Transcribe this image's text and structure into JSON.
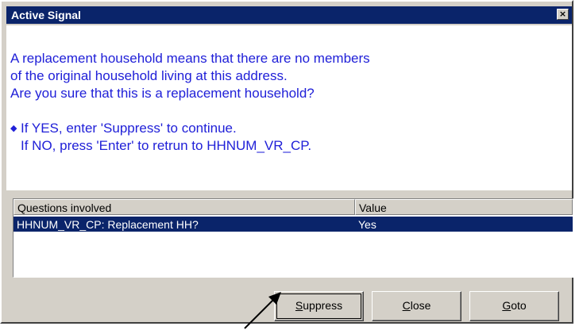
{
  "window": {
    "title": "Active Signal",
    "close_glyph": "×"
  },
  "message": {
    "lines": [
      "A replacement household means that there are no members",
      "of the original household living at this address.",
      "Are you sure that this is a replacement household?"
    ],
    "bullet": "◆",
    "instruction_1": "If YES, enter 'Suppress' to continue.",
    "instruction_2": "If NO, press 'Enter' to retrun to HHNUM_VR_CP."
  },
  "grid": {
    "headers": [
      "Questions involved",
      "Value"
    ],
    "rows": [
      {
        "question": "HHNUM_VR_CP: Replacement HH?",
        "value": "Yes"
      }
    ]
  },
  "buttons": {
    "suppress": {
      "accel": "S",
      "rest": "uppress"
    },
    "close": {
      "accel": "C",
      "rest": "lose"
    },
    "goto": {
      "accel": "G",
      "rest": "oto"
    }
  },
  "colors": {
    "accent": "#0a246a",
    "message_text": "#2020d8",
    "face": "#d4d0c8"
  },
  "icons": {
    "pointer": "arrow-pointer-icon"
  }
}
